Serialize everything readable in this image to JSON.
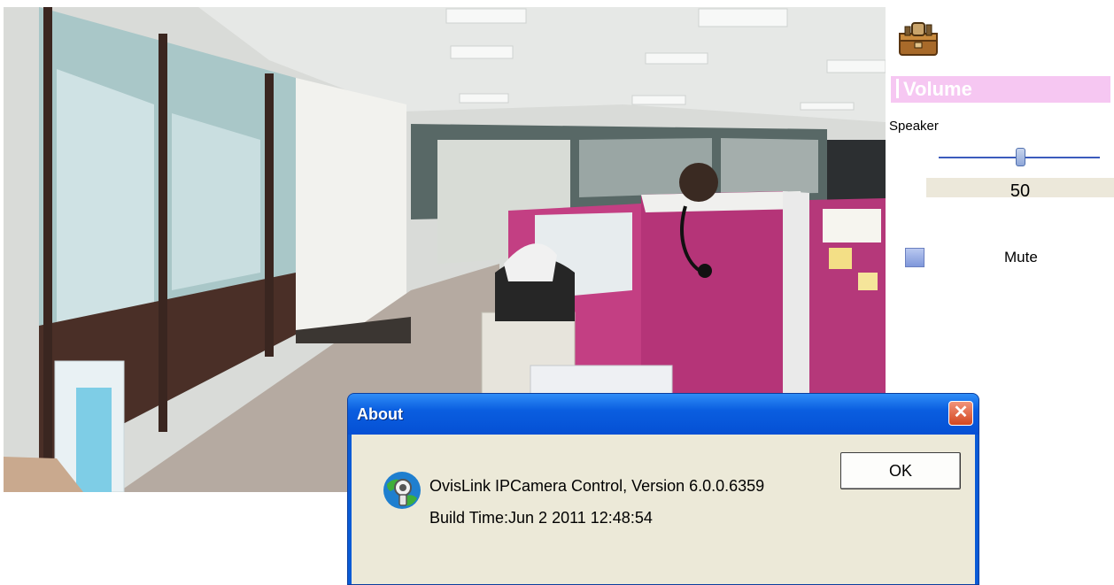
{
  "panel": {
    "volume_title": "Volume",
    "speaker_label": "Speaker",
    "volume_value": "50",
    "mute_label": "Mute"
  },
  "about_dialog": {
    "title": "About",
    "close_glyph": "✕",
    "app_line": "OvisLink IPCamera Control, Version 6.0.0.6359",
    "build_line": "Build Time:Jun  2 2011   12:48:54",
    "ok_label": "OK"
  },
  "colors": {
    "volume_header_bg": "#f6c7f2",
    "dialog_titlebar": "#0a5ee0",
    "dialog_body": "#ece9d8",
    "slider_track": "#3b5bbd"
  },
  "icons": [
    "toolbox-icon",
    "slider-thumb",
    "close-icon",
    "globe-camera-icon"
  ]
}
